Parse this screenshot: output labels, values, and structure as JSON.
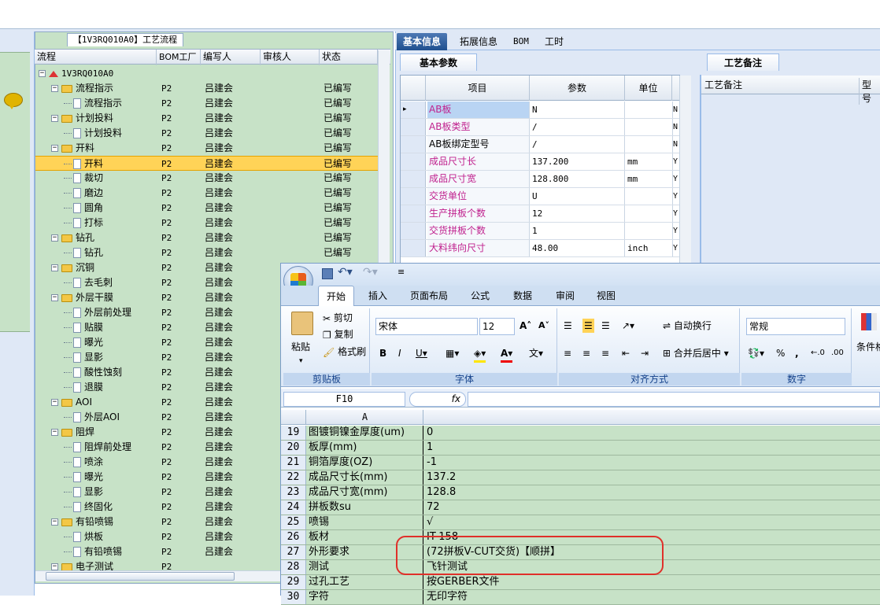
{
  "tree_panel": {
    "tab_title": "【1V3RQ010A0】工艺流程",
    "columns": [
      "流程",
      "BOM工厂",
      "编写人",
      "审核人",
      "状态"
    ],
    "rows": [
      {
        "name": "1V3RQ010A0",
        "level": 0,
        "type": "root",
        "bom": "",
        "writer": "",
        "status": ""
      },
      {
        "name": "流程指示",
        "level": 1,
        "type": "folder",
        "bom": "P2",
        "writer": "吕建会",
        "status": "已编写"
      },
      {
        "name": "流程指示",
        "level": 2,
        "type": "doc",
        "bom": "P2",
        "writer": "吕建会",
        "status": "已编写"
      },
      {
        "name": "计划投料",
        "level": 1,
        "type": "folder",
        "bom": "P2",
        "writer": "吕建会",
        "status": "已编写"
      },
      {
        "name": "计划投料",
        "level": 2,
        "type": "doc",
        "bom": "P2",
        "writer": "吕建会",
        "status": "已编写"
      },
      {
        "name": "开料",
        "level": 1,
        "type": "folder",
        "bom": "P2",
        "writer": "吕建会",
        "status": "已编写"
      },
      {
        "name": "开料",
        "level": 2,
        "type": "doc",
        "bom": "P2",
        "writer": "吕建会",
        "status": "已编写",
        "selected": true
      },
      {
        "name": "裁切",
        "level": 2,
        "type": "doc",
        "bom": "P2",
        "writer": "吕建会",
        "status": "已编写"
      },
      {
        "name": "磨边",
        "level": 2,
        "type": "doc",
        "bom": "P2",
        "writer": "吕建会",
        "status": "已编写"
      },
      {
        "name": "圆角",
        "level": 2,
        "type": "doc",
        "bom": "P2",
        "writer": "吕建会",
        "status": "已编写"
      },
      {
        "name": "打标",
        "level": 2,
        "type": "doc",
        "bom": "P2",
        "writer": "吕建会",
        "status": "已编写"
      },
      {
        "name": "钻孔",
        "level": 1,
        "type": "folder",
        "bom": "P2",
        "writer": "吕建会",
        "status": "已编写"
      },
      {
        "name": "钻孔",
        "level": 2,
        "type": "doc",
        "bom": "P2",
        "writer": "吕建会",
        "status": "已编写"
      },
      {
        "name": "沉铜",
        "level": 1,
        "type": "folder",
        "bom": "P2",
        "writer": "吕建会",
        "status": ""
      },
      {
        "name": "去毛刺",
        "level": 2,
        "type": "doc",
        "bom": "P2",
        "writer": "吕建会",
        "status": ""
      },
      {
        "name": "外层干膜",
        "level": 1,
        "type": "folder",
        "bom": "P2",
        "writer": "吕建会",
        "status": ""
      },
      {
        "name": "外层前处理",
        "level": 2,
        "type": "doc",
        "bom": "P2",
        "writer": "吕建会",
        "status": ""
      },
      {
        "name": "贴膜",
        "level": 2,
        "type": "doc",
        "bom": "P2",
        "writer": "吕建会",
        "status": ""
      },
      {
        "name": "曝光",
        "level": 2,
        "type": "doc",
        "bom": "P2",
        "writer": "吕建会",
        "status": ""
      },
      {
        "name": "显影",
        "level": 2,
        "type": "doc",
        "bom": "P2",
        "writer": "吕建会",
        "status": ""
      },
      {
        "name": "酸性蚀刻",
        "level": 2,
        "type": "doc",
        "bom": "P2",
        "writer": "吕建会",
        "status": ""
      },
      {
        "name": "退膜",
        "level": 2,
        "type": "doc",
        "bom": "P2",
        "writer": "吕建会",
        "status": ""
      },
      {
        "name": "AOI",
        "level": 1,
        "type": "folder",
        "bom": "P2",
        "writer": "吕建会",
        "status": ""
      },
      {
        "name": "外层AOI",
        "level": 2,
        "type": "doc",
        "bom": "P2",
        "writer": "吕建会",
        "status": ""
      },
      {
        "name": "阻焊",
        "level": 1,
        "type": "folder",
        "bom": "P2",
        "writer": "吕建会",
        "status": ""
      },
      {
        "name": "阻焊前处理",
        "level": 2,
        "type": "doc",
        "bom": "P2",
        "writer": "吕建会",
        "status": ""
      },
      {
        "name": "喷涂",
        "level": 2,
        "type": "doc",
        "bom": "P2",
        "writer": "吕建会",
        "status": ""
      },
      {
        "name": "曝光",
        "level": 2,
        "type": "doc",
        "bom": "P2",
        "writer": "吕建会",
        "status": ""
      },
      {
        "name": "显影",
        "level": 2,
        "type": "doc",
        "bom": "P2",
        "writer": "吕建会",
        "status": ""
      },
      {
        "name": "终固化",
        "level": 2,
        "type": "doc",
        "bom": "P2",
        "writer": "吕建会",
        "status": ""
      },
      {
        "name": "有铅喷锡",
        "level": 1,
        "type": "folder",
        "bom": "P2",
        "writer": "吕建会",
        "status": ""
      },
      {
        "name": "烘板",
        "level": 2,
        "type": "doc",
        "bom": "P2",
        "writer": "吕建会",
        "status": ""
      },
      {
        "name": "有铅喷锡",
        "level": 2,
        "type": "doc",
        "bom": "P2",
        "writer": "吕建会",
        "status": ""
      },
      {
        "name": "电子测试",
        "level": 1,
        "type": "folder",
        "bom": "P2",
        "writer": "",
        "status": ""
      }
    ]
  },
  "right_tabs": [
    "基本信息",
    "拓展信息",
    "BOM",
    "工时"
  ],
  "basic_params": {
    "tab": "基本参数",
    "columns": [
      "项目",
      "参数",
      "单位"
    ],
    "rows": [
      {
        "item": "AB板",
        "value": "N",
        "unit": "",
        "flag": "N",
        "pink": true
      },
      {
        "item": "AB板类型",
        "value": "/",
        "unit": "",
        "flag": "N",
        "pink": true
      },
      {
        "item": "AB板绑定型号",
        "value": "/",
        "unit": "",
        "flag": "N",
        "pink": false
      },
      {
        "item": "成品尺寸长",
        "value": "137.200",
        "unit": "mm",
        "flag": "Y",
        "pink": true
      },
      {
        "item": "成品尺寸宽",
        "value": "128.800",
        "unit": "mm",
        "flag": "Y",
        "pink": true
      },
      {
        "item": "交货单位",
        "value": "U",
        "unit": "",
        "flag": "Y",
        "pink": true
      },
      {
        "item": "生产拼板个数",
        "value": "12",
        "unit": "",
        "flag": "Y",
        "pink": true
      },
      {
        "item": "交货拼板个数",
        "value": "1",
        "unit": "",
        "flag": "Y",
        "pink": true
      },
      {
        "item": "大料纬向尺寸",
        "value": "48.00",
        "unit": "inch",
        "flag": "Y",
        "pink": true
      }
    ]
  },
  "notes_panel": {
    "tab": "工艺备注",
    "col1": "工艺备注",
    "col2": "型号"
  },
  "excel": {
    "tabs": [
      "开始",
      "插入",
      "页面布局",
      "公式",
      "数据",
      "审阅",
      "视图"
    ],
    "clipboard": {
      "paste": "粘贴",
      "cut": "剪切",
      "copy": "复制",
      "format_painter": "格式刷",
      "label": "剪贴板"
    },
    "font": {
      "name": "宋体",
      "size": "12",
      "label": "字体"
    },
    "alignment": {
      "wrap": "自动换行",
      "merge": "合并后居中",
      "label": "对齐方式"
    },
    "number": {
      "format": "常规",
      "label": "数字"
    },
    "styles": {
      "conditional": "条件格"
    },
    "name_box": "F10",
    "fx": "fx",
    "column_a": "A",
    "rows": [
      {
        "n": "19",
        "a": "图镀铜镍金厚度(um)",
        "b": "0"
      },
      {
        "n": "20",
        "a": "板厚(mm)",
        "b": "1"
      },
      {
        "n": "21",
        "a": "铜箔厚度(OZ)",
        "b": "-1"
      },
      {
        "n": "22",
        "a": "成品尺寸长(mm)",
        "b": "137.2"
      },
      {
        "n": "23",
        "a": "成品尺寸宽(mm)",
        "b": "128.8"
      },
      {
        "n": "24",
        "a": "拼板数su",
        "b": "72"
      },
      {
        "n": "25",
        "a": "喷锡",
        "b": "√"
      },
      {
        "n": "26",
        "a": "板材",
        "b": "IT-158"
      },
      {
        "n": "27",
        "a": "外形要求",
        "b": "(72拼板V-CUT交货)【顺拼】"
      },
      {
        "n": "28",
        "a": "测试",
        "b": "飞针测试"
      },
      {
        "n": "29",
        "a": "过孔工艺",
        "b": "按GERBER文件"
      },
      {
        "n": "30",
        "a": "字符",
        "b": "无印字符"
      }
    ]
  },
  "colors": {
    "tree_bg": "#c7e2c7",
    "selected_row": "#ffd357",
    "accent_tab": "#2a5a9a",
    "pink_text": "#c0218e",
    "highlight_oval": "#e0302a"
  }
}
